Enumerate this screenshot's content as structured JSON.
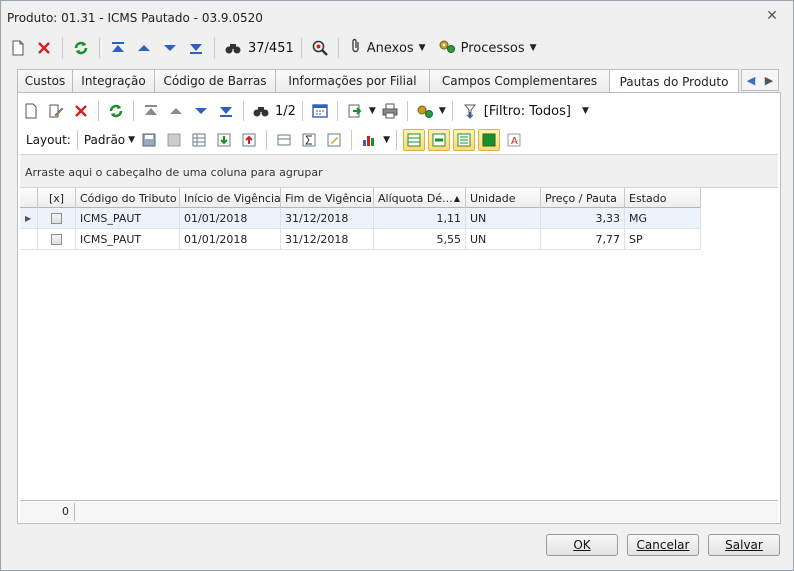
{
  "window": {
    "title": "Produto: 01.31 - ICMS Pautado - 03.9.0520",
    "close_glyph": "✕"
  },
  "toolbar": {
    "record_counter": "37/451",
    "attachments_label": "Anexos",
    "processes_label": "Processos"
  },
  "tabs": [
    {
      "label": "Custos"
    },
    {
      "label": "Integração"
    },
    {
      "label": "Código de Barras"
    },
    {
      "label": "Informações por Filial"
    },
    {
      "label": "Campos Complementares"
    },
    {
      "label": "Pautas do Produto"
    }
  ],
  "sub_toolbar": {
    "record_counter": "1/2",
    "filter_label": "[Filtro: Todos]",
    "layout_label": "Layout:",
    "layout_value": "Padrão"
  },
  "group_panel": {
    "hint": "Arraste aqui o cabeçalho de uma coluna para agrupar"
  },
  "grid": {
    "columns": [
      "[x]",
      "Código do Tributo",
      "Início de Vigência",
      "Fim de Vigência",
      "Alíquota Dé...",
      "Unidade",
      "Preço / Pauta",
      "Estado"
    ],
    "rows": [
      {
        "code": "ICMS_PAUT",
        "start": "01/01/2018",
        "end": "31/12/2018",
        "rate": "1,11",
        "unit": "UN",
        "price": "3,33",
        "state": "MG"
      },
      {
        "code": "ICMS_PAUT",
        "start": "01/01/2018",
        "end": "31/12/2018",
        "rate": "5,55",
        "unit": "UN",
        "price": "7,77",
        "state": "SP"
      }
    ],
    "footer_count": "0"
  },
  "buttons": {
    "ok": "OK",
    "cancel": "Cancelar",
    "save": "Salvar"
  },
  "colors": {
    "accent_blue": "#2f5fbf",
    "delete_red": "#d42020",
    "refresh_green": "#1a8f2a"
  }
}
